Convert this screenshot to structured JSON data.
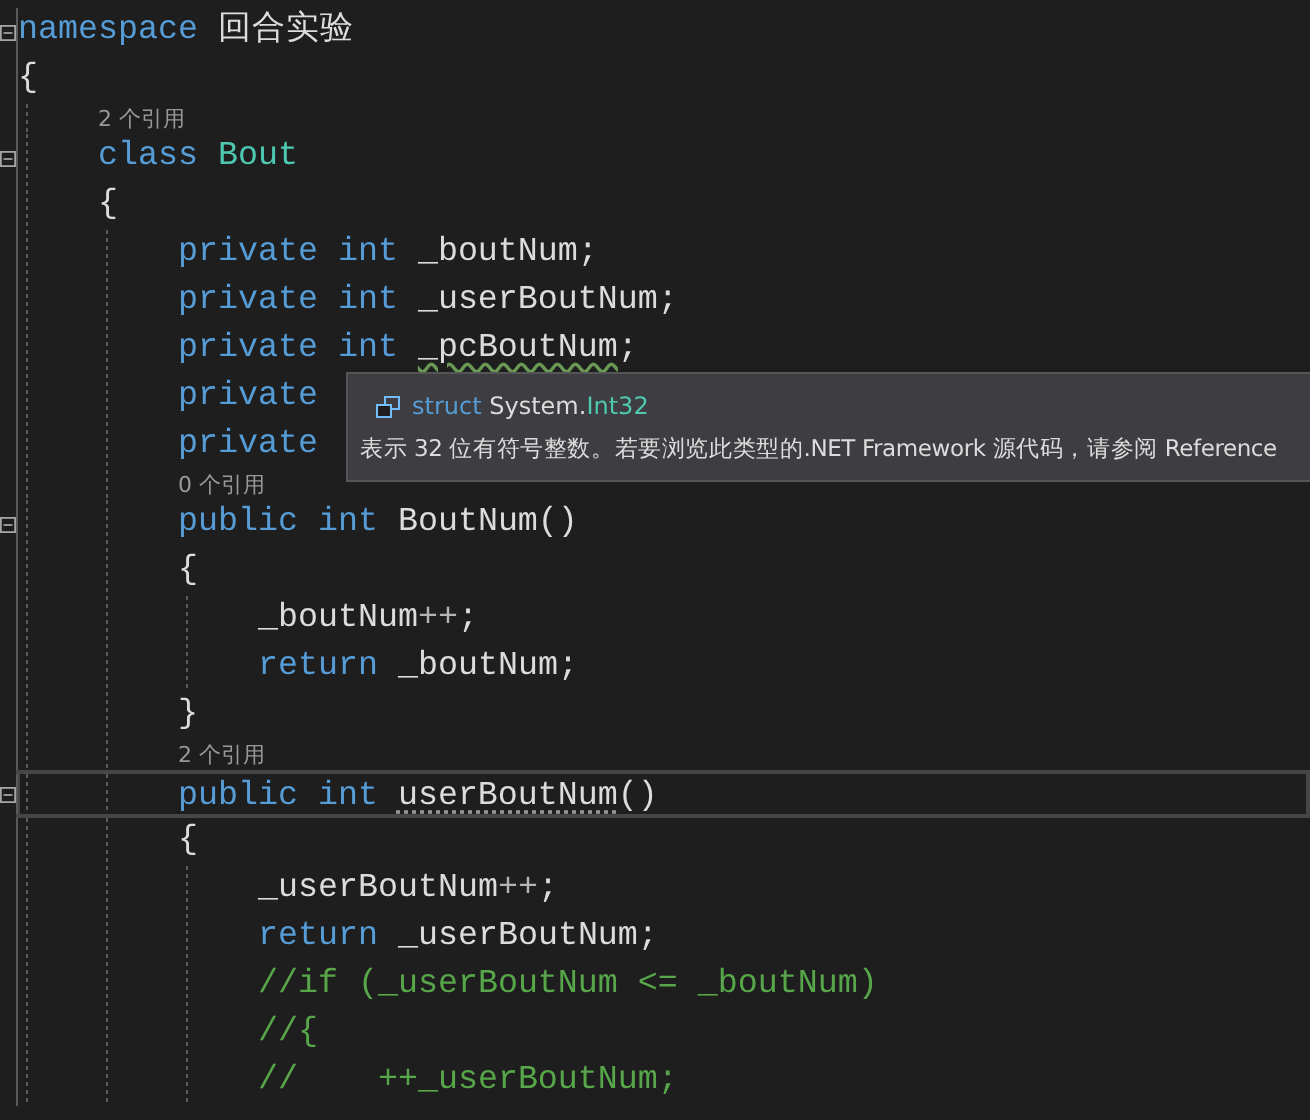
{
  "editor": {
    "lines": [
      {
        "kind": "code",
        "fold": true,
        "tokens": [
          {
            "kind": "keyword",
            "text": "namespace"
          },
          {
            "kind": "plain",
            "text": " 回合实验"
          }
        ]
      },
      {
        "kind": "code",
        "tokens": [
          {
            "kind": "plain",
            "text": "{"
          }
        ],
        "children": [
          {
            "kind": "codelens",
            "text": "2 个引用"
          },
          {
            "kind": "code",
            "fold": true,
            "tokens": [
              {
                "kind": "keyword",
                "text": "class"
              },
              {
                "kind": "type",
                "text": " Bout"
              }
            ]
          },
          {
            "kind": "code",
            "tokens": [
              {
                "kind": "plain",
                "text": "{"
              }
            ],
            "children": [
              {
                "kind": "code",
                "tokens": [
                  {
                    "kind": "keyword",
                    "text": "private int"
                  },
                  {
                    "kind": "plain",
                    "text": " _boutNum;"
                  }
                ]
              },
              {
                "kind": "code",
                "tokens": [
                  {
                    "kind": "keyword",
                    "text": "private int"
                  },
                  {
                    "kind": "plain",
                    "text": " _userBoutNum;"
                  }
                ]
              },
              {
                "kind": "code",
                "tokens": [
                  {
                    "kind": "keyword",
                    "text": "private int "
                  },
                  {
                    "kind": "plain",
                    "text": "_pcBoutNum",
                    "squiggly": true
                  },
                  {
                    "kind": "plain",
                    "text": ";"
                  }
                ]
              },
              {
                "kind": "code",
                "tokens": [
                  {
                    "kind": "keyword",
                    "text": "private"
                  }
                ]
              },
              {
                "kind": "code",
                "tokens": [
                  {
                    "kind": "keyword",
                    "text": "private"
                  }
                ]
              },
              {
                "kind": "codelens",
                "text": "0 个引用"
              },
              {
                "kind": "code",
                "fold": true,
                "tokens": [
                  {
                    "kind": "keyword",
                    "text": "public int"
                  },
                  {
                    "kind": "plain",
                    "text": " BoutNum()"
                  }
                ]
              },
              {
                "kind": "code",
                "tokens": [
                  {
                    "kind": "plain",
                    "text": "{"
                  }
                ],
                "children": [
                  {
                    "kind": "code",
                    "tokens": [
                      {
                        "kind": "plain",
                        "text": "_boutNum"
                      },
                      {
                        "kind": "operator",
                        "text": "++"
                      },
                      {
                        "kind": "plain",
                        "text": ";"
                      }
                    ]
                  },
                  {
                    "kind": "code",
                    "tokens": [
                      {
                        "kind": "keyword",
                        "text": "return"
                      },
                      {
                        "kind": "plain",
                        "text": " _boutNum;"
                      }
                    ]
                  }
                ]
              },
              {
                "kind": "code",
                "tokens": [
                  {
                    "kind": "plain",
                    "text": "}"
                  }
                ]
              },
              {
                "kind": "codelens",
                "text": "2 个引用"
              },
              {
                "kind": "code",
                "fold": true,
                "current": true,
                "tokens": [
                  {
                    "kind": "keyword",
                    "text": "public int "
                  },
                  {
                    "kind": "plain",
                    "text": "userBoutNum",
                    "dotted_underline": true
                  },
                  {
                    "kind": "plain",
                    "text": "()"
                  }
                ]
              },
              {
                "kind": "code",
                "tokens": [
                  {
                    "kind": "plain",
                    "text": "{"
                  }
                ],
                "children": [
                  {
                    "kind": "code",
                    "tokens": [
                      {
                        "kind": "plain",
                        "text": "_userBoutNum"
                      },
                      {
                        "kind": "operator",
                        "text": "++"
                      },
                      {
                        "kind": "plain",
                        "text": ";"
                      }
                    ]
                  },
                  {
                    "kind": "code",
                    "tokens": [
                      {
                        "kind": "keyword",
                        "text": "return"
                      },
                      {
                        "kind": "plain",
                        "text": " _userBoutNum;"
                      }
                    ]
                  },
                  {
                    "kind": "code",
                    "tokens": [
                      {
                        "kind": "comment",
                        "text": "//if (_userBoutNum <= _boutNum)"
                      }
                    ]
                  },
                  {
                    "kind": "code",
                    "tokens": [
                      {
                        "kind": "comment",
                        "text": "//{"
                      }
                    ]
                  },
                  {
                    "kind": "code",
                    "tokens": [
                      {
                        "kind": "comment",
                        "text": "//    ++_userBoutNum;"
                      }
                    ]
                  }
                ]
              }
            ]
          }
        ]
      }
    ]
  },
  "quick_info": {
    "keyword": "struct",
    "namespace": "System.",
    "type_name": "Int32",
    "description": "表示 32 位有符号整数。若要浏览此类型的.NET Framework 源代码，请参阅 Reference"
  }
}
